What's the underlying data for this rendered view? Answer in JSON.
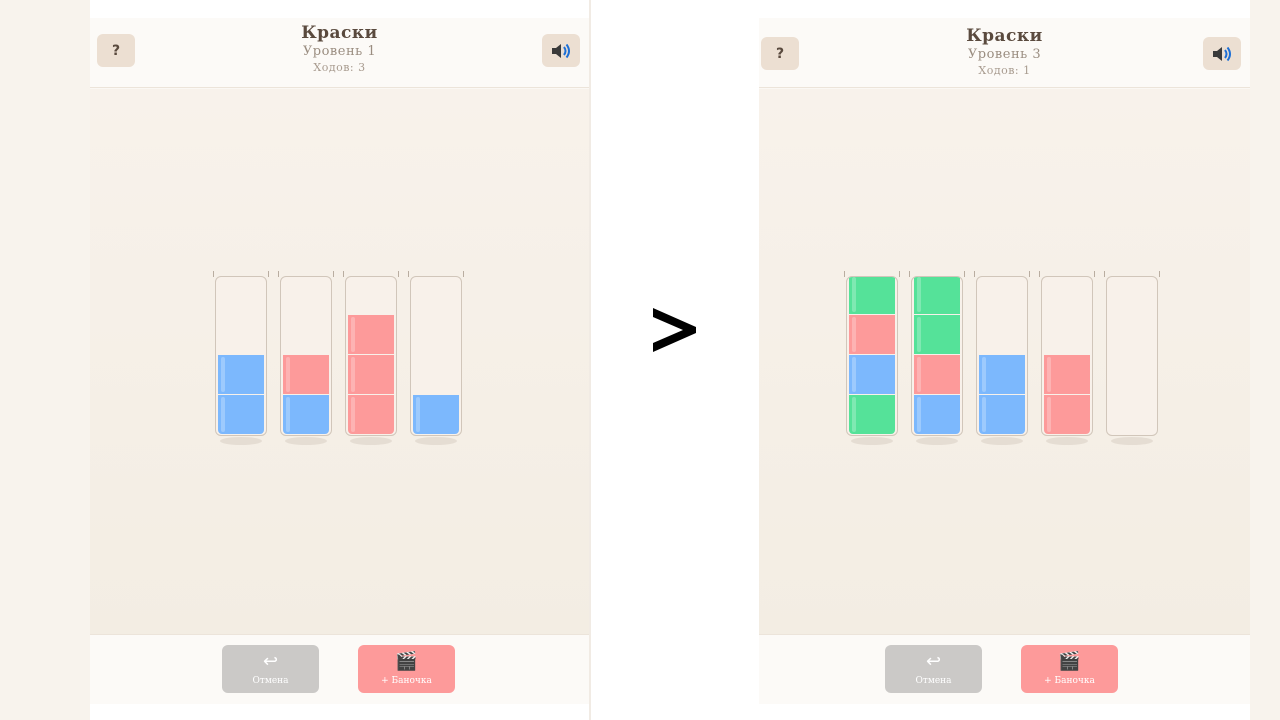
{
  "colors": {
    "blue": "#7cb8fd",
    "red": "#fd9a9a",
    "green": "#55e299",
    "sound": "#1d6fd6"
  },
  "left": {
    "title": "Краски",
    "level": "Уровень 1",
    "moves": "Ходов: 3",
    "help_label": "?",
    "sound_icon": "speaker-icon",
    "tubes": [
      [
        "blue",
        "blue"
      ],
      [
        "blue",
        "red"
      ],
      [
        "red",
        "red",
        "red"
      ],
      [
        "blue"
      ]
    ],
    "undo_label": "Отмена",
    "add_label": "+ Баночка"
  },
  "right": {
    "title": "Краски",
    "level": "Уровень 3",
    "moves": "Ходов: 1",
    "help_label": "?",
    "sound_icon": "speaker-icon",
    "tubes": [
      [
        "green",
        "blue",
        "red",
        "green"
      ],
      [
        "blue",
        "red",
        "green",
        "green"
      ],
      [
        "blue",
        "blue"
      ],
      [
        "red",
        "red"
      ],
      []
    ],
    "undo_label": "Отмена",
    "add_label": "+ Баночка"
  },
  "arrow_icon": "greater-than-arrow-icon"
}
